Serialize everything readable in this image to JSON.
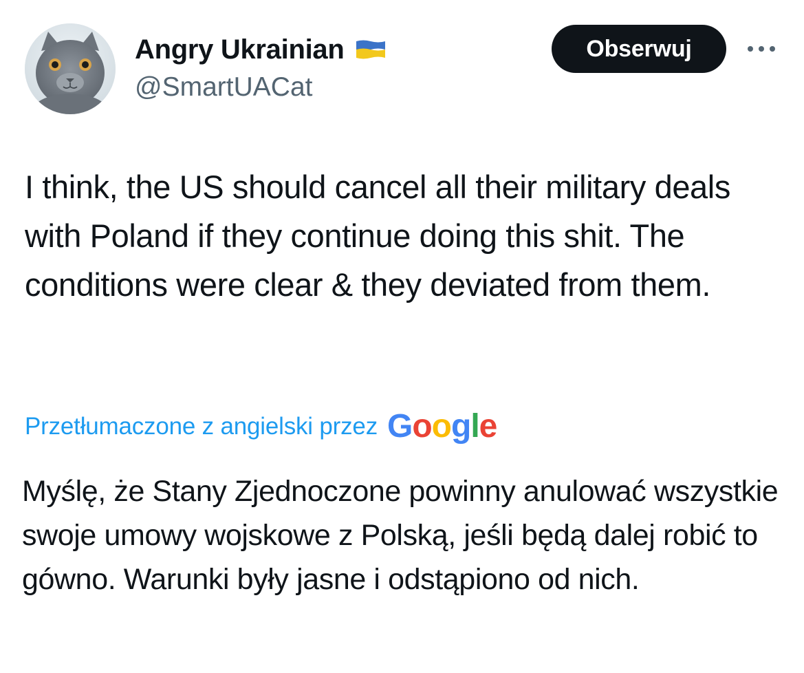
{
  "author": {
    "display_name": "Angry Ukrainian",
    "handle": "@SmartUACat",
    "flag_colors": {
      "top": "#3b73c8",
      "bottom": "#f2c81c"
    }
  },
  "actions": {
    "follow_label": "Obserwuj",
    "more_icon": "more-horizontal-icon"
  },
  "tweet": {
    "text": "I think, the US should cancel all their military deals with Poland if they continue doing this shit. The conditions were clear & they deviated from them."
  },
  "translation": {
    "label": "Przetłumaczone z angielski przez",
    "provider": "Google",
    "provider_letters": [
      "G",
      "o",
      "o",
      "g",
      "l",
      "e"
    ],
    "text": "Myślę, że Stany Zjednoczone powinny anulować wszystkie swoje umowy wojskowe z Polską, jeśli będą dalej robić to gówno. Warunki były jasne i odstąpiono od nich."
  },
  "colors": {
    "link": "#1d9bf0",
    "secondary_text": "#536471",
    "button_bg": "#0f1419"
  }
}
